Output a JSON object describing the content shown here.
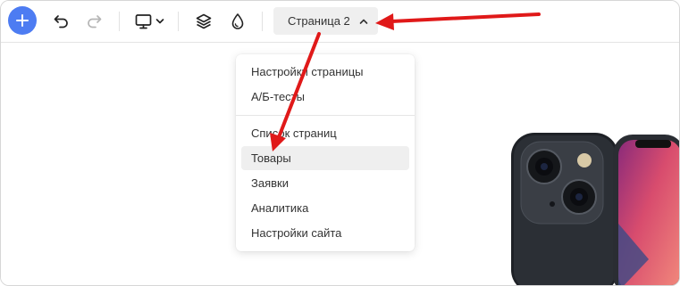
{
  "toolbar": {
    "page_selector_label": "Страница 2"
  },
  "menu": {
    "items": [
      {
        "label": "Настройки страницы"
      },
      {
        "label": "А/Б-тесты"
      },
      {
        "label": "Список страниц"
      },
      {
        "label": "Товары"
      },
      {
        "label": "Заявки"
      },
      {
        "label": "Аналитика"
      },
      {
        "label": "Настройки сайта"
      }
    ]
  },
  "icons": {
    "add": "plus-icon",
    "undo": "undo-icon",
    "redo": "redo-icon",
    "device": "monitor-icon",
    "layers": "layers-icon",
    "theme": "drop-icon",
    "chevron": "chevron-up-icon"
  },
  "colors": {
    "accent": "#4d7cf2",
    "annotation": "#e01919"
  }
}
